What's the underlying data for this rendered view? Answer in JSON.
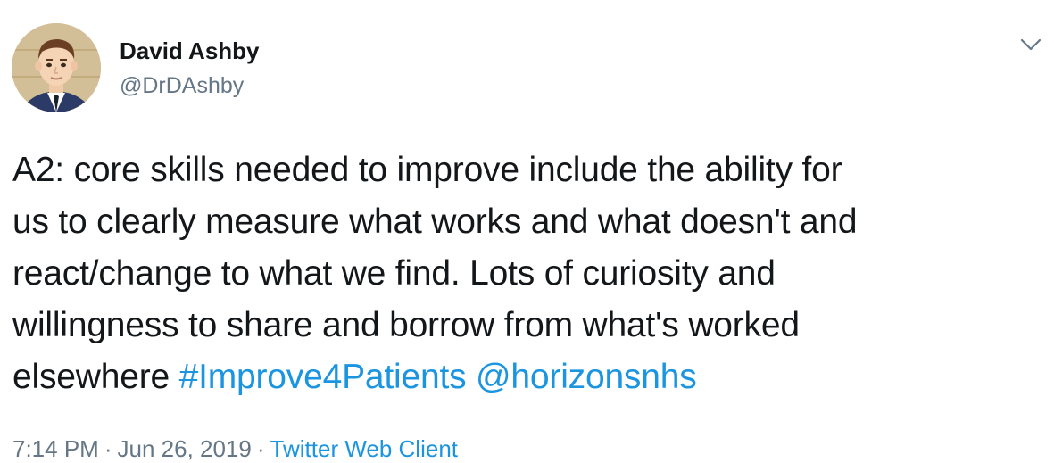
{
  "author": {
    "name": "David Ashby",
    "handle": "@DrDAshby",
    "avatar_icon": "cartoon-man-avatar"
  },
  "menu": {
    "icon": "chevron-down-icon"
  },
  "tweet": {
    "lines": [
      "A2: core skills needed to improve include the ability for",
      "us to clearly measure what works and what doesn't and",
      "react/change to what we find. Lots of curiosity and",
      "willingness to share and borrow from what's worked"
    ],
    "last_line_prefix": "elsewhere ",
    "hashtag": "#Improve4Patients",
    "mention": "@horizonsnhs"
  },
  "meta": {
    "time": "7:14 PM",
    "separator": "·",
    "date": "Jun 26, 2019",
    "source": "Twitter Web Client"
  },
  "colors": {
    "text": "#14171a",
    "secondary": "#657786",
    "link": "#1b95e0"
  }
}
